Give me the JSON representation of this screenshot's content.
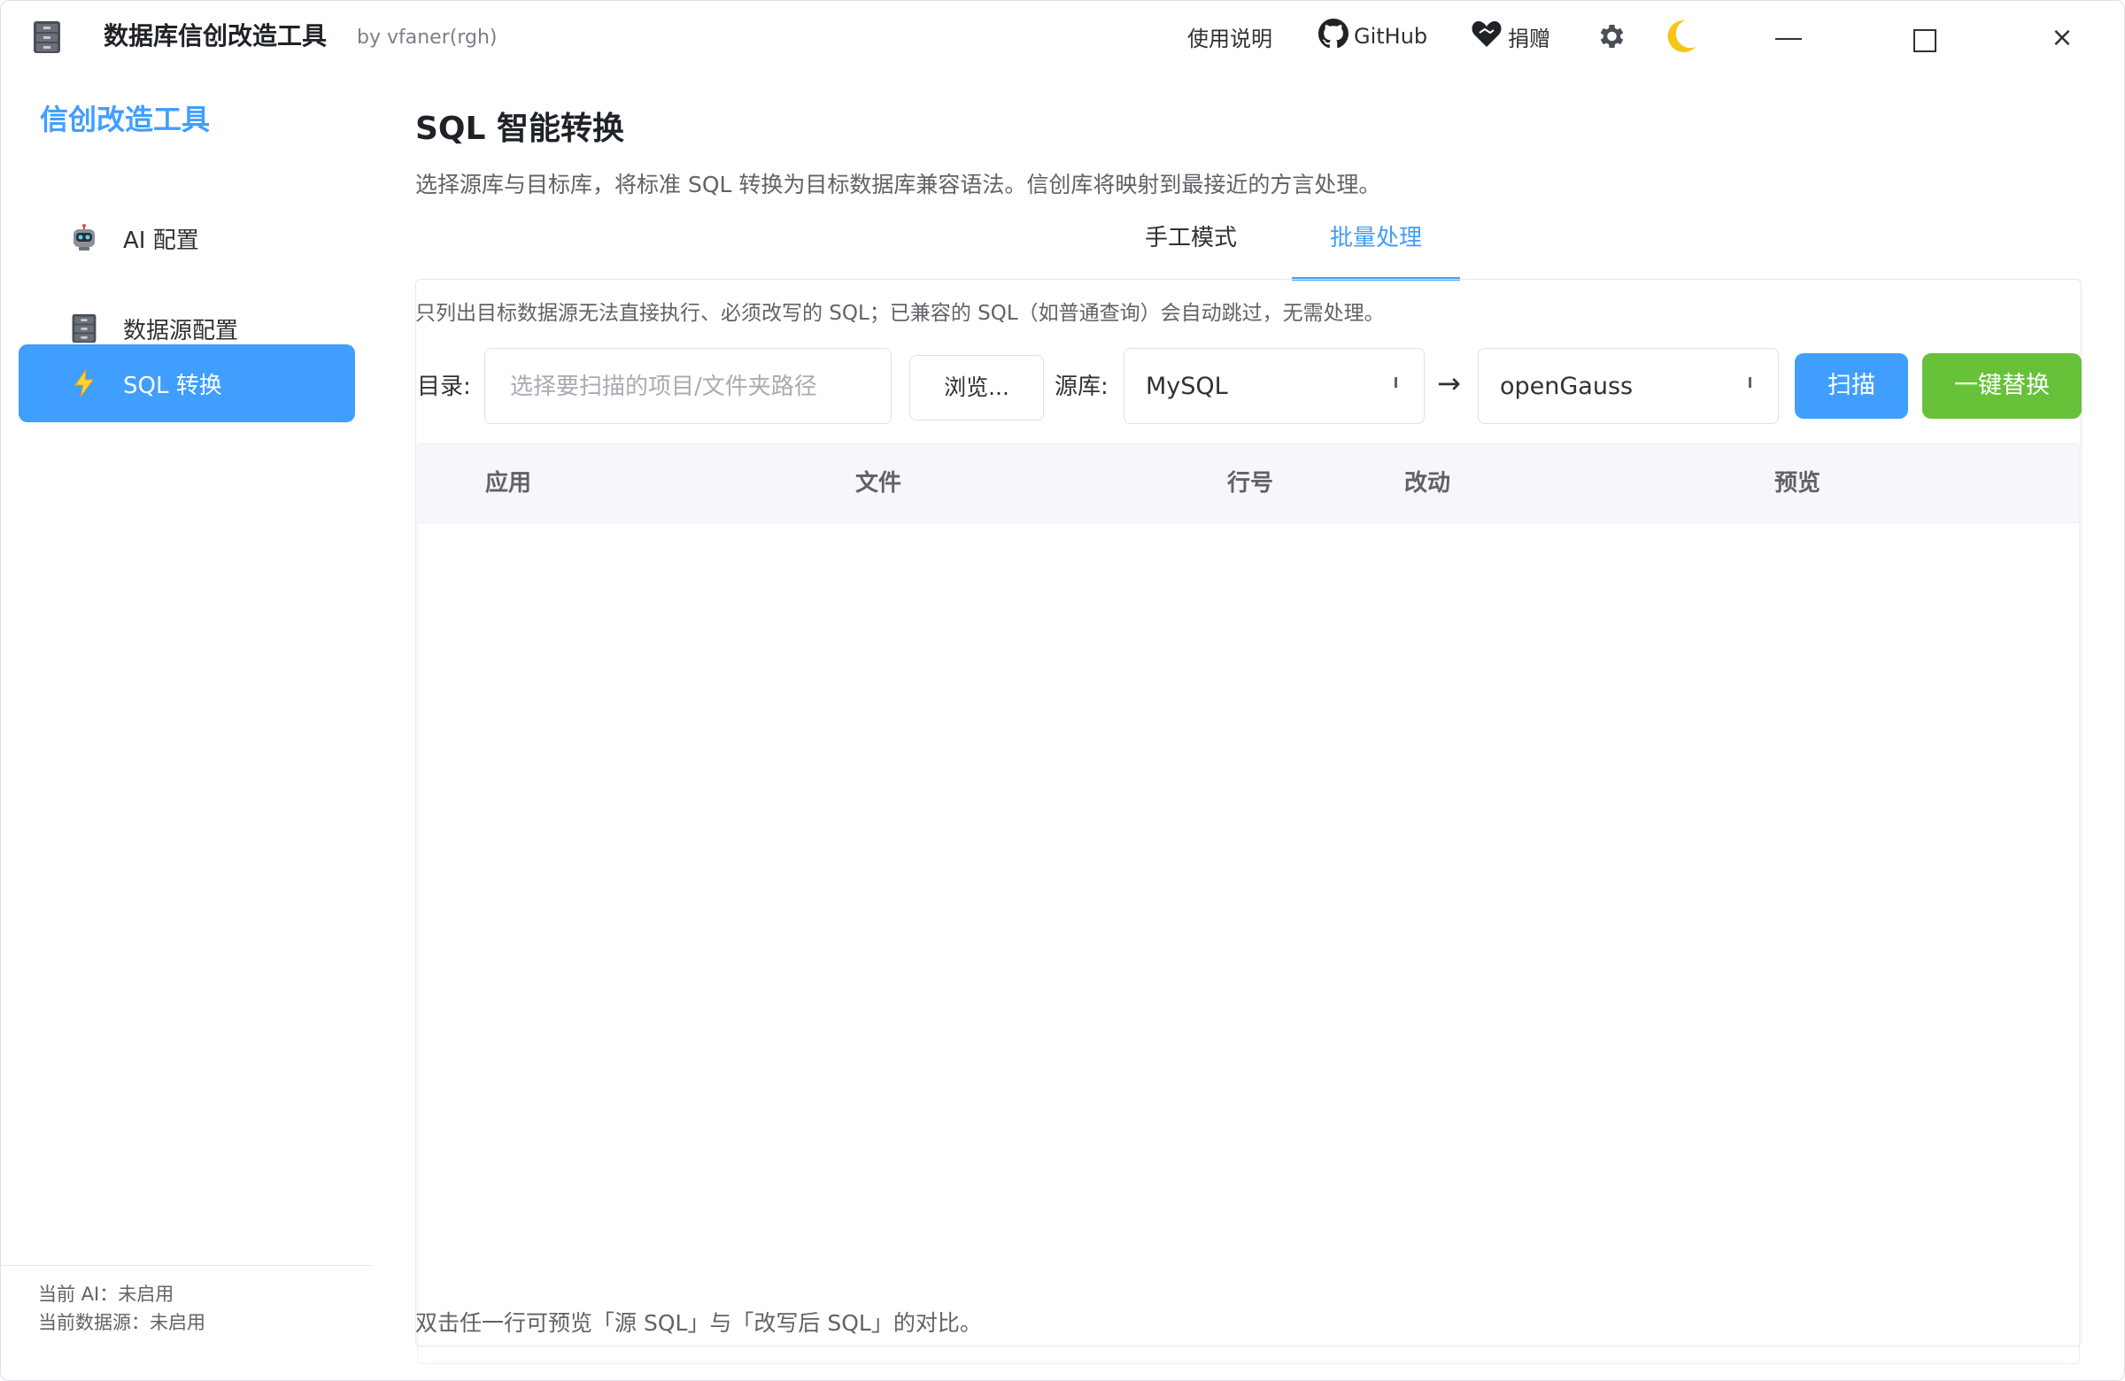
{
  "titlebar": {
    "app_icon": "file-cabinet-icon",
    "title": "数据库信创改造工具",
    "author": "by vfaner(rgh)",
    "help_label": "使用说明",
    "github_label": "GitHub",
    "donate_label": "捐赠",
    "settings_icon": "gear-icon",
    "theme_icon": "moon-icon"
  },
  "sidebar": {
    "brand": "信创改造工具",
    "items": [
      {
        "label": "AI 配置",
        "icon": "robot-icon"
      },
      {
        "label": "数据源配置",
        "icon": "file-cabinet-icon"
      },
      {
        "label": "SQL 转换",
        "icon": "lightning-icon",
        "active": true
      }
    ],
    "status_ai": "当前 AI：未启用",
    "status_datasource": "当前数据源：未启用"
  },
  "main": {
    "title": "SQL 智能转换",
    "description": "选择源库与目标库，将标准 SQL 转换为目标数据库兼容语法。信创库将映射到最接近的方言处理。",
    "tabs": [
      {
        "label": "手工模式"
      },
      {
        "label": "批量处理",
        "active": true
      }
    ],
    "hint": "只列出目标数据源无法直接执行、必须改写的 SQL；已兼容的 SQL（如普通查询）会自动跳过，无需处理。",
    "dir_label": "目录:",
    "dir_placeholder": "选择要扫描的项目/文件夹路径",
    "browse_label": "浏览...",
    "source_label": "源库:",
    "source_value": "MySQL",
    "arrow": "→",
    "target_value": "openGauss",
    "scan_label": "扫描",
    "replace_label": "一键替换",
    "table_columns": [
      "应用",
      "文件",
      "行号",
      "改动",
      "预览"
    ],
    "footnote": "双击任一行可预览「源 SQL」与「改写后 SQL」的对比。"
  },
  "colors": {
    "accent": "#409eff",
    "success": "#67c23a"
  }
}
